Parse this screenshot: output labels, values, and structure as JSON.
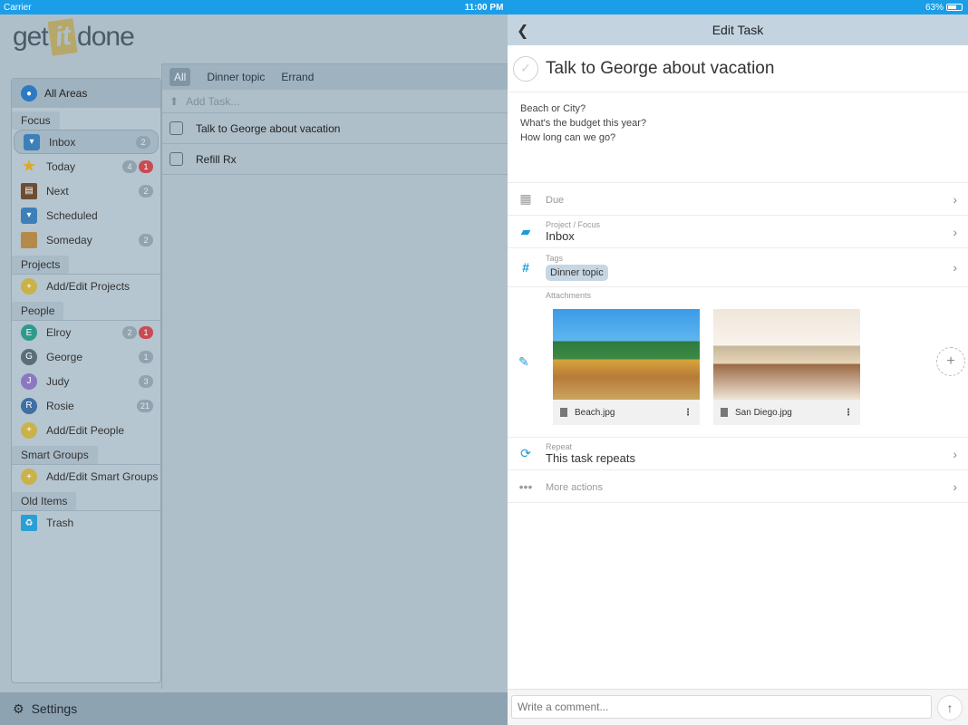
{
  "status": {
    "carrier": "Carrier",
    "time": "11:00 PM",
    "battery": "63%"
  },
  "logo": {
    "part1": "get",
    "part2": "it",
    "part3": "done"
  },
  "sidebar": {
    "all_areas": "All Areas",
    "sections": {
      "focus": "Focus",
      "projects": "Projects",
      "people": "People",
      "smart_groups": "Smart Groups",
      "old_items": "Old Items"
    },
    "focus_items": [
      {
        "label": "Inbox",
        "count": "2"
      },
      {
        "label": "Today",
        "count": "4",
        "overdue": "1"
      },
      {
        "label": "Next",
        "count": "2"
      },
      {
        "label": "Scheduled",
        "count": ""
      },
      {
        "label": "Someday",
        "count": "2"
      }
    ],
    "projects_items": [
      {
        "label": "Add/Edit Projects"
      }
    ],
    "people_items": [
      {
        "initial": "E",
        "label": "Elroy",
        "count": "2",
        "overdue": "1",
        "color": "#2f9a8c"
      },
      {
        "initial": "G",
        "label": "George",
        "count": "1",
        "color": "#5a6e7a"
      },
      {
        "initial": "J",
        "label": "Judy",
        "count": "3",
        "color": "#8a78c0"
      },
      {
        "initial": "R",
        "label": "Rosie",
        "count": "21",
        "color": "#3e6fa5"
      },
      {
        "label": "Add/Edit People"
      }
    ],
    "smart_groups_items": [
      {
        "label": "Add/Edit Smart Groups"
      }
    ],
    "old_items": [
      {
        "label": "Trash"
      }
    ]
  },
  "list": {
    "filters": [
      "All",
      "Dinner topic",
      "Errand"
    ],
    "add_task_placeholder": "Add Task...",
    "tasks": [
      {
        "title": "Talk to George about vacation"
      },
      {
        "title": "Refill Rx"
      }
    ]
  },
  "settings": {
    "label": "Settings"
  },
  "edit": {
    "header": "Edit Task",
    "title": "Talk to George about vacation",
    "notes": [
      "Beach or City?",
      "What's the budget this year?",
      "How long can we go?"
    ],
    "due_label": "Due",
    "project_label": "Project / Focus",
    "project_value": "Inbox",
    "tags_label": "Tags",
    "tag": "Dinner topic",
    "attachments_label": "Attachments",
    "attachments": [
      {
        "name": "Beach.jpg"
      },
      {
        "name": "San Diego.jpg"
      }
    ],
    "repeat_label": "Repeat",
    "repeat_value": "This task repeats",
    "more_actions": "More actions",
    "comment_placeholder": "Write a comment..."
  },
  "colors": {
    "accent": "#1a9bd7",
    "statusbar": "#1a9ee8",
    "header": "#c3d3e0",
    "overdue": "#c94b55"
  }
}
